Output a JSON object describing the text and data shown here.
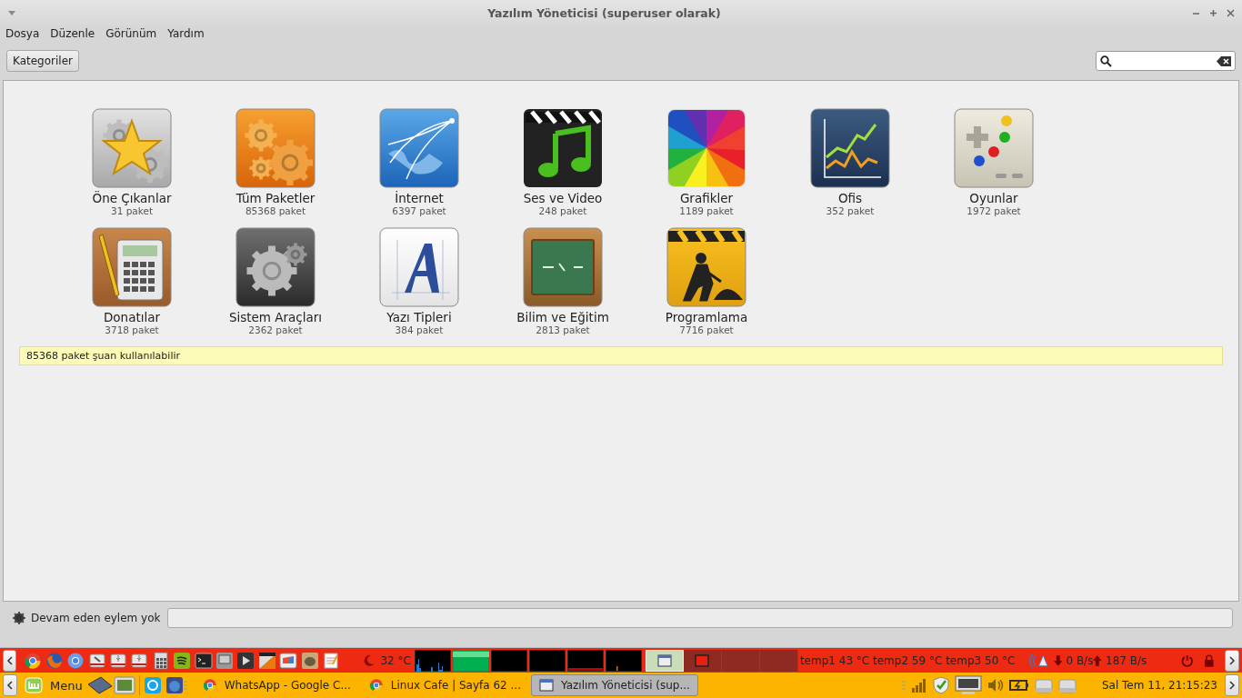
{
  "window": {
    "title": "Yazılım Yöneticisi (superuser olarak)"
  },
  "menu": [
    "Dosya",
    "Düzenle",
    "Görünüm",
    "Yardım"
  ],
  "toolbar": {
    "button": "Kategoriler"
  },
  "categories": [
    {
      "name": "Öne Çıkanlar",
      "count": "31 paket"
    },
    {
      "name": "Tüm Paketler",
      "count": "85368 paket"
    },
    {
      "name": "İnternet",
      "count": "6397 paket"
    },
    {
      "name": "Ses ve Video",
      "count": "248 paket"
    },
    {
      "name": "Grafikler",
      "count": "1189 paket"
    },
    {
      "name": "Ofis",
      "count": "352 paket"
    },
    {
      "name": "Oyunlar",
      "count": "1972 paket"
    },
    {
      "name": "Donatılar",
      "count": "3718 paket"
    },
    {
      "name": "Sistem Araçları",
      "count": "2362 paket"
    },
    {
      "name": "Yazı Tipleri",
      "count": "384 paket"
    },
    {
      "name": "Bilim ve Eğitim",
      "count": "2813 paket"
    },
    {
      "name": "Programlama",
      "count": "7716 paket"
    }
  ],
  "info_bar": "85368 paket şuan kullanılabilir",
  "status_bar": {
    "text": "Devam eden eylem yok",
    "level": 0
  },
  "top_panel": {
    "temperature": "32 °C",
    "workspaces": [
      {
        "selected": true
      },
      {
        "selected": false
      },
      {
        "selected": false
      },
      {
        "selected": false
      }
    ],
    "sensors": "temp1 43 °C temp2 59 °C temp3 50 °C",
    "download": "0 B/s",
    "upload": "187 B/s"
  },
  "bottom_panel": {
    "menu": "Menu",
    "windows": [
      {
        "title": "WhatsApp - Google C...",
        "kind": "browser",
        "selected": false
      },
      {
        "title": "Linux Cafe | Sayfa 62 ...",
        "kind": "browser",
        "selected": false
      },
      {
        "title": "Yazılım Yöneticisi (sup...",
        "kind": "app",
        "selected": true
      }
    ],
    "clock": "Sal Tem 11, 21:15:23"
  }
}
